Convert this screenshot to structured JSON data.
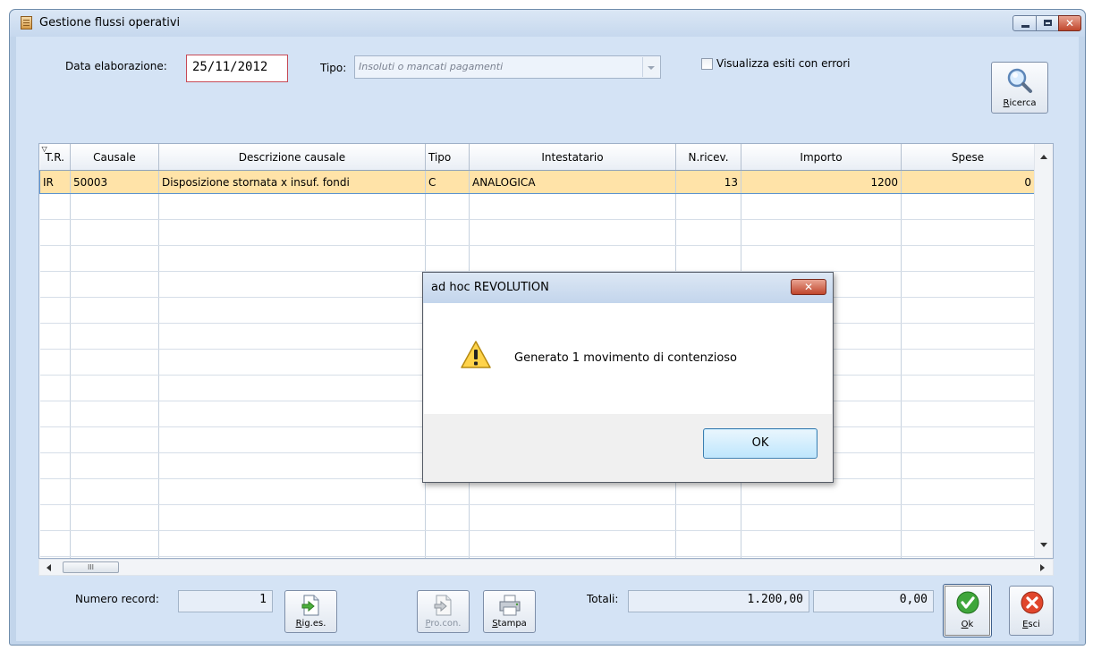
{
  "window": {
    "title": "Gestione flussi operativi",
    "close_glyph": "✕"
  },
  "form": {
    "date_label": "Data elaborazione:",
    "date_value": "25/11/2012",
    "tipo_label": "Tipo:",
    "tipo_value": "Insoluti o mancati pagamenti",
    "visualizza_label": "Visualizza esiti con errori",
    "visualizza_checked": false
  },
  "ricerca_button": {
    "accel": "R",
    "rest": "icerca"
  },
  "grid": {
    "columns": [
      "T.R.",
      "Causale",
      "Descrizione causale",
      "Tipo",
      "Intestatario",
      "N.ricev.",
      "Importo",
      "Spese"
    ],
    "rows": [
      {
        "tr": "IR",
        "causale": "50003",
        "descrizione": "Disposizione stornata x insuf. fondi",
        "tipo": "C",
        "intestatario": "ANALOGICA",
        "nricev": "13",
        "importo": "1200",
        "spese": "0"
      }
    ],
    "hscroll_thumb": "III"
  },
  "footer": {
    "numero_record_label": "Numero record:",
    "numero_record_value": "1",
    "totali_label": "Totali:",
    "totale_importo": "1.200,00",
    "totale_spese": "0,00",
    "rig_es": {
      "accel": "R",
      "rest": "ig.es."
    },
    "pro_con": {
      "accel": "P",
      "rest": "ro.con."
    },
    "stampa": {
      "accel": "S",
      "rest": "tampa"
    },
    "ok": {
      "accel": "O",
      "rest": "k"
    },
    "esci": {
      "accel": "E",
      "rest": "sci"
    }
  },
  "dialog": {
    "title": "ad hoc REVOLUTION",
    "message": "Generato 1 movimento di contenzioso",
    "ok_label": "OK",
    "close_glyph": "✕"
  },
  "colors": {
    "selected_row": "#ffe3a8",
    "window_bg": "#d4e3f5",
    "date_border": "#c64a56"
  }
}
